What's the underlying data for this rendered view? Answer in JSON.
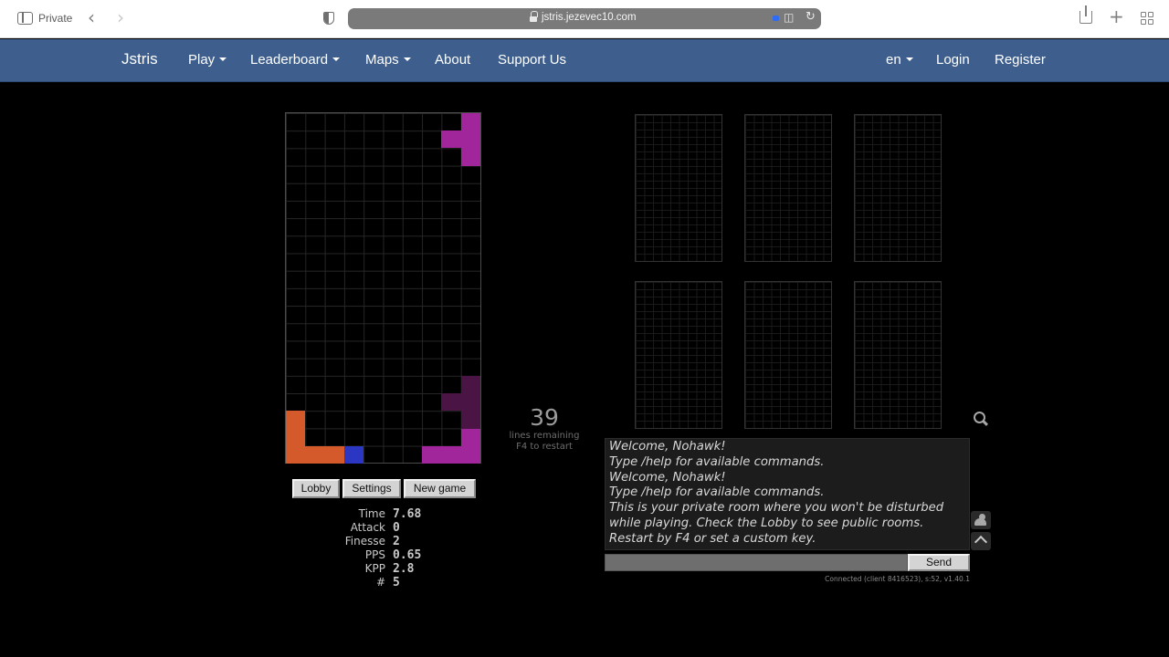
{
  "browser": {
    "private_label": "Private",
    "url": "jstris.jezevec10.com",
    "icons": [
      "sidebar-icon",
      "back-icon",
      "forward-icon",
      "shield-icon",
      "lock-icon",
      "translate-icon",
      "reload-icon",
      "share-icon",
      "new-tab-icon",
      "tabs-icon"
    ]
  },
  "navbar": {
    "brand": "Jstris",
    "menu": [
      {
        "label": "Play",
        "dropdown": true
      },
      {
        "label": "Leaderboard",
        "dropdown": true
      },
      {
        "label": "Maps",
        "dropdown": true
      },
      {
        "label": "About",
        "dropdown": false
      },
      {
        "label": "Support Us",
        "dropdown": false
      }
    ],
    "language": "en",
    "login": "Login",
    "register": "Register",
    "color": "#3e5f8d"
  },
  "game": {
    "lines_remaining": "39",
    "lines_remaining_label": "lines remaining",
    "restart_hint": "F4 to restart",
    "piece_colors": {
      "magenta": "#a1269c",
      "dark_purple": "#4a1544",
      "orange": "#d45a2b",
      "blue": "#2b37c3"
    },
    "buttons": {
      "lobby": "Lobby",
      "settings": "Settings",
      "new_game": "New game"
    },
    "stats": [
      {
        "label": "Time",
        "value": "7.68"
      },
      {
        "label": "Attack",
        "value": "0"
      },
      {
        "label": "Finesse",
        "value": "2"
      },
      {
        "label": "PPS",
        "value": "0.65"
      },
      {
        "label": "KPP",
        "value": "2.8"
      },
      {
        "label": "#",
        "value": "5"
      }
    ]
  },
  "chat": {
    "lines": [
      "Welcome, Nohawk!",
      "Type /help for available commands.",
      "Welcome, Nohawk!",
      "Type /help for available commands.",
      "This is your private room where you won't be disturbed",
      "while playing. Check the Lobby to see public rooms.",
      "Restart by F4 or set a custom key."
    ],
    "input_value": "",
    "send_label": "Send",
    "connection_status": "Connected (client 8416523), s:52, v1.40.1"
  }
}
